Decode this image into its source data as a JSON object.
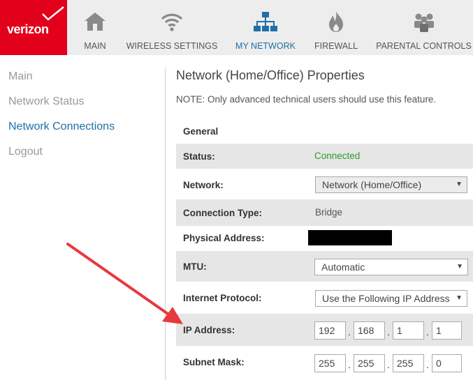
{
  "brand": {
    "logo_text": "verizon",
    "color": "#e3001b"
  },
  "nav": {
    "items": [
      {
        "label": "MAIN",
        "icon": "home-icon"
      },
      {
        "label": "WIRELESS SETTINGS",
        "icon": "wifi-icon"
      },
      {
        "label": "MY NETWORK",
        "icon": "network-icon",
        "active": true
      },
      {
        "label": "FIREWALL",
        "icon": "flame-icon"
      },
      {
        "label": "PARENTAL CONTROLS",
        "icon": "users-icon"
      }
    ],
    "active_color": "#1f6fa8"
  },
  "sidebar": {
    "items": [
      {
        "label": "Main"
      },
      {
        "label": "Network Status"
      },
      {
        "label": "Network Connections",
        "active": true
      },
      {
        "label": "Logout"
      }
    ]
  },
  "main": {
    "title": "Network (Home/Office) Properties",
    "note": "NOTE: Only advanced technical users should use this feature.",
    "section": "General",
    "status": {
      "label": "Status:",
      "value": "Connected",
      "color": "#2e9a2e"
    },
    "network": {
      "label": "Network:",
      "value": "Network (Home/Office)"
    },
    "connection_type": {
      "label": "Connection Type:",
      "value": "Bridge"
    },
    "physical_address": {
      "label": "Physical Address:"
    },
    "mtu": {
      "label": "MTU:",
      "value": "Automatic"
    },
    "internet_protocol": {
      "label": "Internet Protocol:",
      "value": "Use the Following IP Address"
    },
    "ip_address": {
      "label": "IP Address:",
      "octets": [
        "192",
        "168",
        "1",
        "1"
      ]
    },
    "subnet_mask": {
      "label": "Subnet Mask:",
      "octets": [
        "255",
        "255",
        "255",
        "0"
      ]
    },
    "separator": "."
  }
}
